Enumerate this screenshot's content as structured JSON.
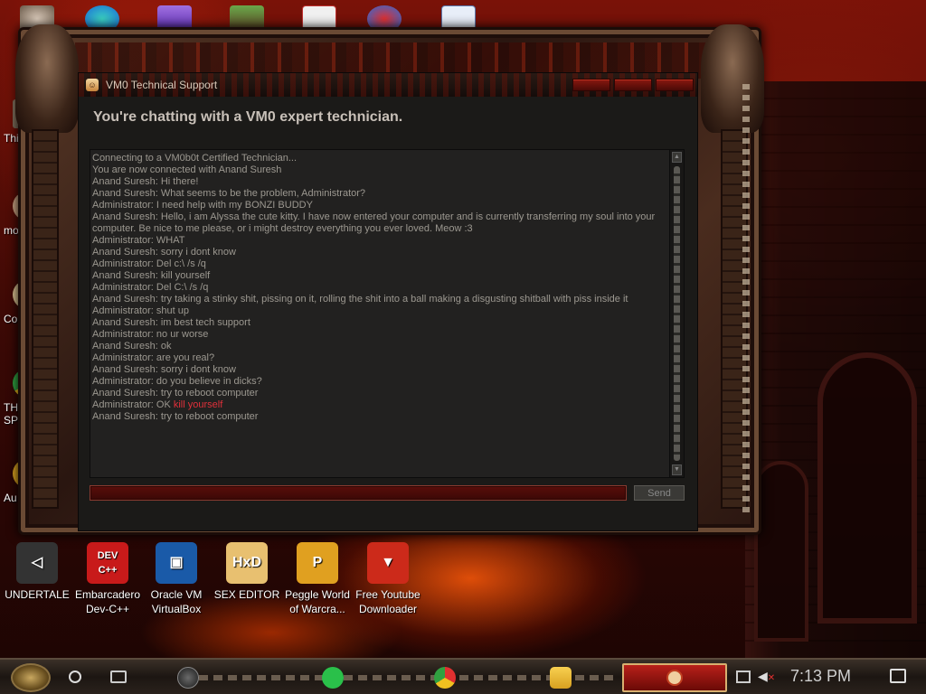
{
  "window": {
    "title": "VM0 Technical Support",
    "headline": "You're chatting with a VM0 expert technician.",
    "send_label": "Send",
    "message_value": ""
  },
  "transcript": [
    {
      "text": "Connecting to a VM0b0t Certified Technician..."
    },
    {
      "text": "You are now connected with Anand Suresh"
    },
    {
      "text": "Anand Suresh: Hi there!"
    },
    {
      "text": "Anand Suresh: What seems to be the problem, Administrator?"
    },
    {
      "text": "Administrator: I need help with my BONZI BUDDY"
    },
    {
      "text": "Anand Suresh: Hello, i am Alyssa the cute kitty. I have now entered your computer and is currently transferring my soul into your computer. Be nice to me please, or i might destroy everything you ever loved. Meow :3"
    },
    {
      "text": "Administrator: WHAT"
    },
    {
      "text": "Anand Suresh: sorry i dont know"
    },
    {
      "text": "Administrator: Del c:\\ /s /q"
    },
    {
      "text": "Anand Suresh: kill yourself"
    },
    {
      "text": "Administrator: Del C:\\ /s /q"
    },
    {
      "text": "Anand Suresh: try taking a stinky shit, pissing on it, rolling the shit into a ball making a disgusting shitball with piss inside it"
    },
    {
      "text": "Administrator: shut up"
    },
    {
      "text": "Anand Suresh: im best tech support"
    },
    {
      "text": "Administrator: no ur worse"
    },
    {
      "text": "Anand Suresh: ok"
    },
    {
      "text": "Administrator: are you real?"
    },
    {
      "text": "Anand Suresh: sorry i dont know"
    },
    {
      "text": "Administrator: do you believe in dicks?"
    },
    {
      "text": "Anand Suresh: try to reboot computer"
    },
    {
      "text": "Administrator: OK ",
      "highlight": "kill yourself"
    },
    {
      "text": "Anand Suresh: try to reboot computer"
    }
  ],
  "left_icons": [
    {
      "label": "This",
      "color": "#7a6a58"
    },
    {
      "label": "moon",
      "color": "#c8a080"
    },
    {
      "label": "Contro",
      "color": "#d8c090"
    },
    {
      "label": "THIS\nSPYW",
      "color": "#2a8ad8"
    },
    {
      "label": "Au",
      "color": "#d8a020"
    }
  ],
  "bottom_icons": [
    {
      "label": "UNDERTALE",
      "icon": "unity-icon",
      "color": "#333333",
      "glyph": "◁"
    },
    {
      "label": "Embarcadero Dev-C++",
      "icon": "devcpp-icon",
      "color": "#c81a1a",
      "glyph": "DEV C++"
    },
    {
      "label": "Oracle VM VirtualBox",
      "icon": "virtualbox-icon",
      "color": "#1a5aa8",
      "glyph": "▣"
    },
    {
      "label": "SEX EDITOR",
      "icon": "hxd-icon",
      "color": "#e8c070",
      "glyph": "HxD"
    },
    {
      "label": "Peggle World of Warcra...",
      "icon": "peggle-icon",
      "color": "#e0a020",
      "glyph": "P"
    },
    {
      "label": "Free Youtube Downloader",
      "icon": "youtube-downloader-icon",
      "color": "#cc2a1a",
      "glyph": "▼"
    }
  ],
  "taskbar": {
    "time": "7:13 PM"
  }
}
